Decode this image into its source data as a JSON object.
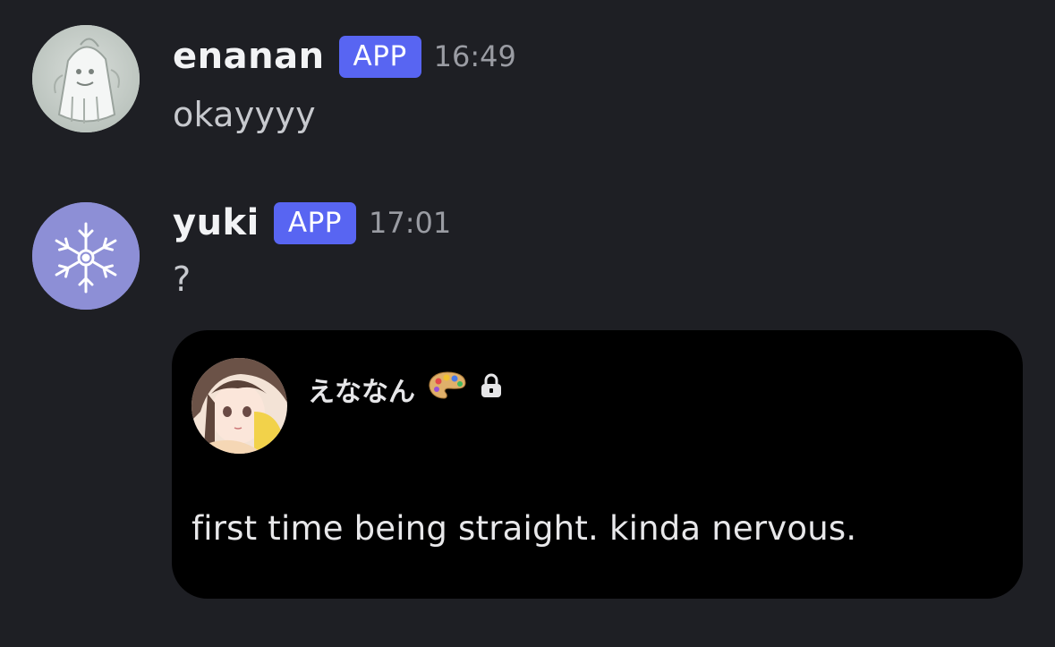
{
  "messages": [
    {
      "username": "enanan",
      "badge": "APP",
      "time": "16:49",
      "text": "okayyyy",
      "avatar_icon": "ghost-sketch-avatar"
    },
    {
      "username": "yuki",
      "badge": "APP",
      "time": "17:01",
      "text": "?",
      "avatar_icon": "snowflake-avatar",
      "embed": {
        "author_name": "えななん",
        "author_icon": "anime-girl-avatar",
        "emoji": "palette-icon",
        "lock": "lock-icon",
        "text": "first time being straight. kinda nervous."
      }
    }
  ],
  "colors": {
    "background": "#1e1f24",
    "badge": "#5865f2",
    "embed_bg": "#000000",
    "timestamp": "#9a9ca3",
    "snowflake_avatar_bg": "#8d8fd6"
  }
}
